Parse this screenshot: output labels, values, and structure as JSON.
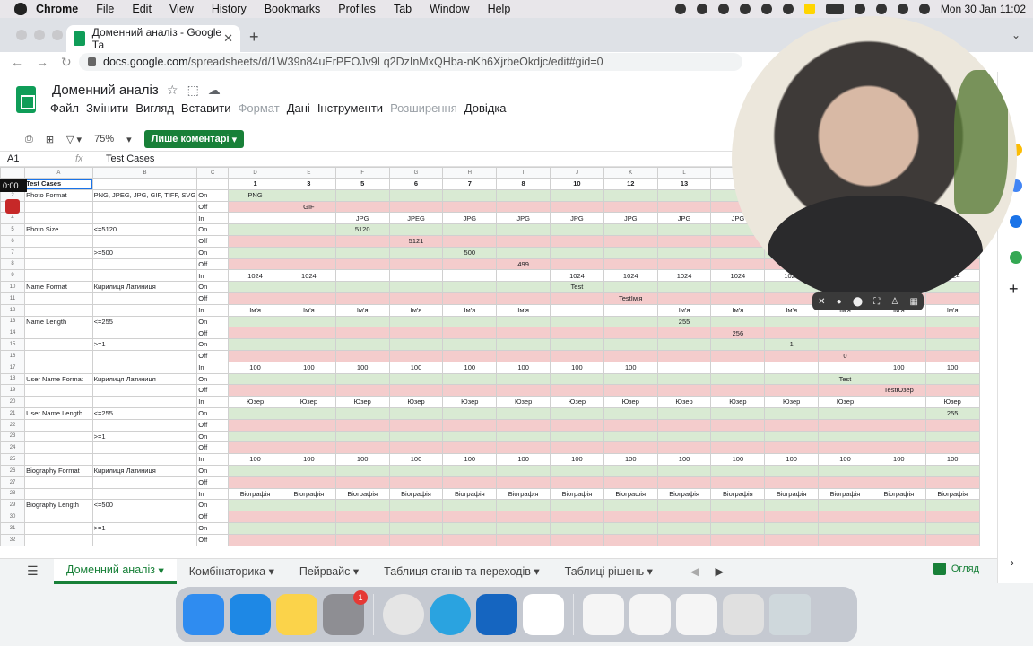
{
  "os_menubar": {
    "app": "Chrome",
    "items": [
      "File",
      "Edit",
      "View",
      "History",
      "Bookmarks",
      "Profiles",
      "Tab",
      "Window",
      "Help"
    ],
    "clock": "Mon 30 Jan  11:02"
  },
  "browser": {
    "tab_title": "Доменний аналіз - Google Та",
    "url_host": "docs.google.com",
    "url_path": "/spreadsheets/d/1W39n84uErPEOJv9Lq2DzInMxQHba-nKh6XjrbeOkdjc/edit#gid=0"
  },
  "doc": {
    "title": "Доменний аналіз",
    "menus": [
      "Файл",
      "Змінити",
      "Вигляд",
      "Вставити",
      "Формат",
      "Дані",
      "Інструменти",
      "Розширення",
      "Довідка"
    ],
    "disabled_menus": [
      "Формат",
      "Розширення"
    ],
    "zoom": "75%",
    "comment_mode": "Лише коментарі",
    "cell_ref": "A1",
    "fx_label": "fx",
    "formula_value": "Test Cases"
  },
  "grid": {
    "columns": [
      "",
      "A",
      "B",
      "C",
      "D",
      "E",
      "F",
      "G",
      "H",
      "I",
      "J",
      "K",
      "L",
      "M",
      "N",
      "O",
      "P",
      "Q",
      "R"
    ],
    "top_row": {
      "label": "Test Cases",
      "numbers": [
        "1",
        "3",
        "5",
        "6",
        "7",
        "8",
        "10",
        "12",
        "13",
        "14",
        "",
        "",
        "",
        ""
      ]
    },
    "rows": [
      {
        "n": "2",
        "a": "Photo Format",
        "b": "PNG, JPEG, JPG, GIF, TIFF, SVG",
        "c": "On",
        "t": "on",
        "v": [
          "PNG",
          "",
          "",
          "",
          "",
          "",
          "",
          "",
          "",
          "",
          "",
          "",
          "",
          ""
        ]
      },
      {
        "n": "3",
        "a": "",
        "b": "",
        "c": "Off",
        "t": "off",
        "v": [
          "",
          "GIF",
          "",
          "",
          "",
          "",
          "",
          "",
          "",
          "",
          "",
          "",
          "",
          ""
        ]
      },
      {
        "n": "4",
        "a": "",
        "b": "",
        "c": "In",
        "t": "in",
        "v": [
          "",
          "",
          "JPG",
          "JPEG",
          "JPG",
          "JPG",
          "JPG",
          "JPG",
          "JPG",
          "JPG",
          "",
          "",
          "",
          ""
        ]
      },
      {
        "n": "5",
        "a": "Photo Size",
        "b": "<=5120",
        "c": "On",
        "t": "on",
        "v": [
          "",
          "",
          "5120",
          "",
          "",
          "",
          "",
          "",
          "",
          "",
          "",
          "",
          "",
          ""
        ]
      },
      {
        "n": "6",
        "a": "",
        "b": "",
        "c": "Off",
        "t": "off",
        "v": [
          "",
          "",
          "",
          "5121",
          "",
          "",
          "",
          "",
          "",
          "",
          "",
          "",
          "",
          ""
        ]
      },
      {
        "n": "7",
        "a": "",
        "b": ">=500",
        "c": "On",
        "t": "on",
        "v": [
          "",
          "",
          "",
          "",
          "500",
          "",
          "",
          "",
          "",
          "",
          "",
          "",
          "",
          ""
        ]
      },
      {
        "n": "8",
        "a": "",
        "b": "",
        "c": "Off",
        "t": "off",
        "v": [
          "",
          "",
          "",
          "",
          "",
          "499",
          "",
          "",
          "",
          "",
          "",
          "",
          "",
          ""
        ]
      },
      {
        "n": "9",
        "a": "",
        "b": "",
        "c": "In",
        "t": "in",
        "v": [
          "1024",
          "1024",
          "",
          "",
          "",
          "",
          "1024",
          "1024",
          "1024",
          "1024",
          "1024",
          "",
          "",
          "1024"
        ]
      },
      {
        "n": "10",
        "a": "Name Format",
        "b": "Кирилиця Латиниця",
        "c": "On",
        "t": "on",
        "v": [
          "",
          "",
          "",
          "",
          "",
          "",
          "Test",
          "",
          "",
          "",
          "",
          "",
          "",
          ""
        ]
      },
      {
        "n": "11",
        "a": "",
        "b": "",
        "c": "Off",
        "t": "off",
        "v": [
          "",
          "",
          "",
          "",
          "",
          "",
          "",
          "TestІм'я",
          "",
          "",
          "",
          "",
          "",
          ""
        ]
      },
      {
        "n": "12",
        "a": "",
        "b": "",
        "c": "In",
        "t": "in",
        "v": [
          "Ім'я",
          "Ім'я",
          "Ім'я",
          "Ім'я",
          "Ім'я",
          "Ім'я",
          "",
          "",
          "Ім'я",
          "Ім'я",
          "Ім'я",
          "Ім'я",
          "Ім'я",
          "Ім'я"
        ]
      },
      {
        "n": "13",
        "a": "Name Length",
        "b": "<=255",
        "c": "On",
        "t": "on",
        "v": [
          "",
          "",
          "",
          "",
          "",
          "",
          "",
          "",
          "255",
          "",
          "",
          "",
          "",
          ""
        ]
      },
      {
        "n": "14",
        "a": "",
        "b": "",
        "c": "Off",
        "t": "off",
        "v": [
          "",
          "",
          "",
          "",
          "",
          "",
          "",
          "",
          "",
          "256",
          "",
          "",
          "",
          ""
        ]
      },
      {
        "n": "15",
        "a": "",
        "b": ">=1",
        "c": "On",
        "t": "on",
        "v": [
          "",
          "",
          "",
          "",
          "",
          "",
          "",
          "",
          "",
          "",
          "1",
          "",
          "",
          ""
        ]
      },
      {
        "n": "16",
        "a": "",
        "b": "",
        "c": "Off",
        "t": "off",
        "v": [
          "",
          "",
          "",
          "",
          "",
          "",
          "",
          "",
          "",
          "",
          "",
          "0",
          "",
          ""
        ]
      },
      {
        "n": "17",
        "a": "",
        "b": "",
        "c": "In",
        "t": "in",
        "v": [
          "100",
          "100",
          "100",
          "100",
          "100",
          "100",
          "100",
          "100",
          "",
          "",
          "",
          "",
          "100",
          "100"
        ]
      },
      {
        "n": "18",
        "a": "User Name Format",
        "b": "Кирилиця Латиниця",
        "c": "On",
        "t": "on",
        "v": [
          "",
          "",
          "",
          "",
          "",
          "",
          "",
          "",
          "",
          "",
          "",
          "Test",
          "",
          ""
        ]
      },
      {
        "n": "19",
        "a": "",
        "b": "",
        "c": "Off",
        "t": "off",
        "v": [
          "",
          "",
          "",
          "",
          "",
          "",
          "",
          "",
          "",
          "",
          "",
          "",
          "TestЮзер",
          ""
        ]
      },
      {
        "n": "20",
        "a": "",
        "b": "",
        "c": "In",
        "t": "in",
        "v": [
          "Юзер",
          "Юзер",
          "Юзер",
          "Юзер",
          "Юзер",
          "Юзер",
          "Юзер",
          "Юзер",
          "Юзер",
          "Юзер",
          "Юзер",
          "Юзер",
          "",
          "Юзер"
        ]
      },
      {
        "n": "21",
        "a": "User Name Length",
        "b": "<=255",
        "c": "On",
        "t": "on",
        "v": [
          "",
          "",
          "",
          "",
          "",
          "",
          "",
          "",
          "",
          "",
          "",
          "",
          "",
          "255"
        ]
      },
      {
        "n": "22",
        "a": "",
        "b": "",
        "c": "Off",
        "t": "off",
        "v": [
          "",
          "",
          "",
          "",
          "",
          "",
          "",
          "",
          "",
          "",
          "",
          "",
          "",
          ""
        ]
      },
      {
        "n": "23",
        "a": "",
        "b": ">=1",
        "c": "On",
        "t": "on",
        "v": [
          "",
          "",
          "",
          "",
          "",
          "",
          "",
          "",
          "",
          "",
          "",
          "",
          "",
          ""
        ]
      },
      {
        "n": "24",
        "a": "",
        "b": "",
        "c": "Off",
        "t": "off",
        "v": [
          "",
          "",
          "",
          "",
          "",
          "",
          "",
          "",
          "",
          "",
          "",
          "",
          "",
          ""
        ]
      },
      {
        "n": "25",
        "a": "",
        "b": "",
        "c": "In",
        "t": "in",
        "v": [
          "100",
          "100",
          "100",
          "100",
          "100",
          "100",
          "100",
          "100",
          "100",
          "100",
          "100",
          "100",
          "100",
          "100"
        ]
      },
      {
        "n": "26",
        "a": "Biography Format",
        "b": "Кирилиця Латиниця",
        "c": "On",
        "t": "on",
        "v": [
          "",
          "",
          "",
          "",
          "",
          "",
          "",
          "",
          "",
          "",
          "",
          "",
          "",
          ""
        ]
      },
      {
        "n": "27",
        "a": "",
        "b": "",
        "c": "Off",
        "t": "off",
        "v": [
          "",
          "",
          "",
          "",
          "",
          "",
          "",
          "",
          "",
          "",
          "",
          "",
          "",
          ""
        ]
      },
      {
        "n": "28",
        "a": "",
        "b": "",
        "c": "In",
        "t": "in",
        "v": [
          "Біографія",
          "Біографія",
          "Біографія",
          "Біографія",
          "Біографія",
          "Біографія",
          "Біографія",
          "Біографія",
          "Біографія",
          "Біографія",
          "Біографія",
          "Біографія",
          "Біографія",
          "Біографія"
        ]
      },
      {
        "n": "29",
        "a": "Biography Length",
        "b": "<=500",
        "c": "On",
        "t": "on",
        "v": [
          "",
          "",
          "",
          "",
          "",
          "",
          "",
          "",
          "",
          "",
          "",
          "",
          "",
          ""
        ]
      },
      {
        "n": "30",
        "a": "",
        "b": "",
        "c": "Off",
        "t": "off",
        "v": [
          "",
          "",
          "",
          "",
          "",
          "",
          "",
          "",
          "",
          "",
          "",
          "",
          "",
          ""
        ]
      },
      {
        "n": "31",
        "a": "",
        "b": ">=1",
        "c": "On",
        "t": "on",
        "v": [
          "",
          "",
          "",
          "",
          "",
          "",
          "",
          "",
          "",
          "",
          "",
          "",
          "",
          ""
        ]
      },
      {
        "n": "32",
        "a": "",
        "b": "",
        "c": "Off",
        "t": "off",
        "v": [
          "",
          "",
          "",
          "",
          "",
          "",
          "",
          "",
          "",
          "",
          "",
          "",
          "",
          ""
        ]
      }
    ]
  },
  "sheet_tabs": [
    "Доменний аналіз",
    "Комбінаторика",
    "Пейрвайс",
    "Таблиця станів та переходів",
    "Таблиці рішень"
  ],
  "explore_label": "Огляд",
  "recorder": {
    "time": "0:00"
  },
  "dock": {
    "badge_count": "1"
  },
  "colors": {
    "on": "#d9ead3",
    "off": "#f4cccc",
    "accent": "#188038"
  }
}
